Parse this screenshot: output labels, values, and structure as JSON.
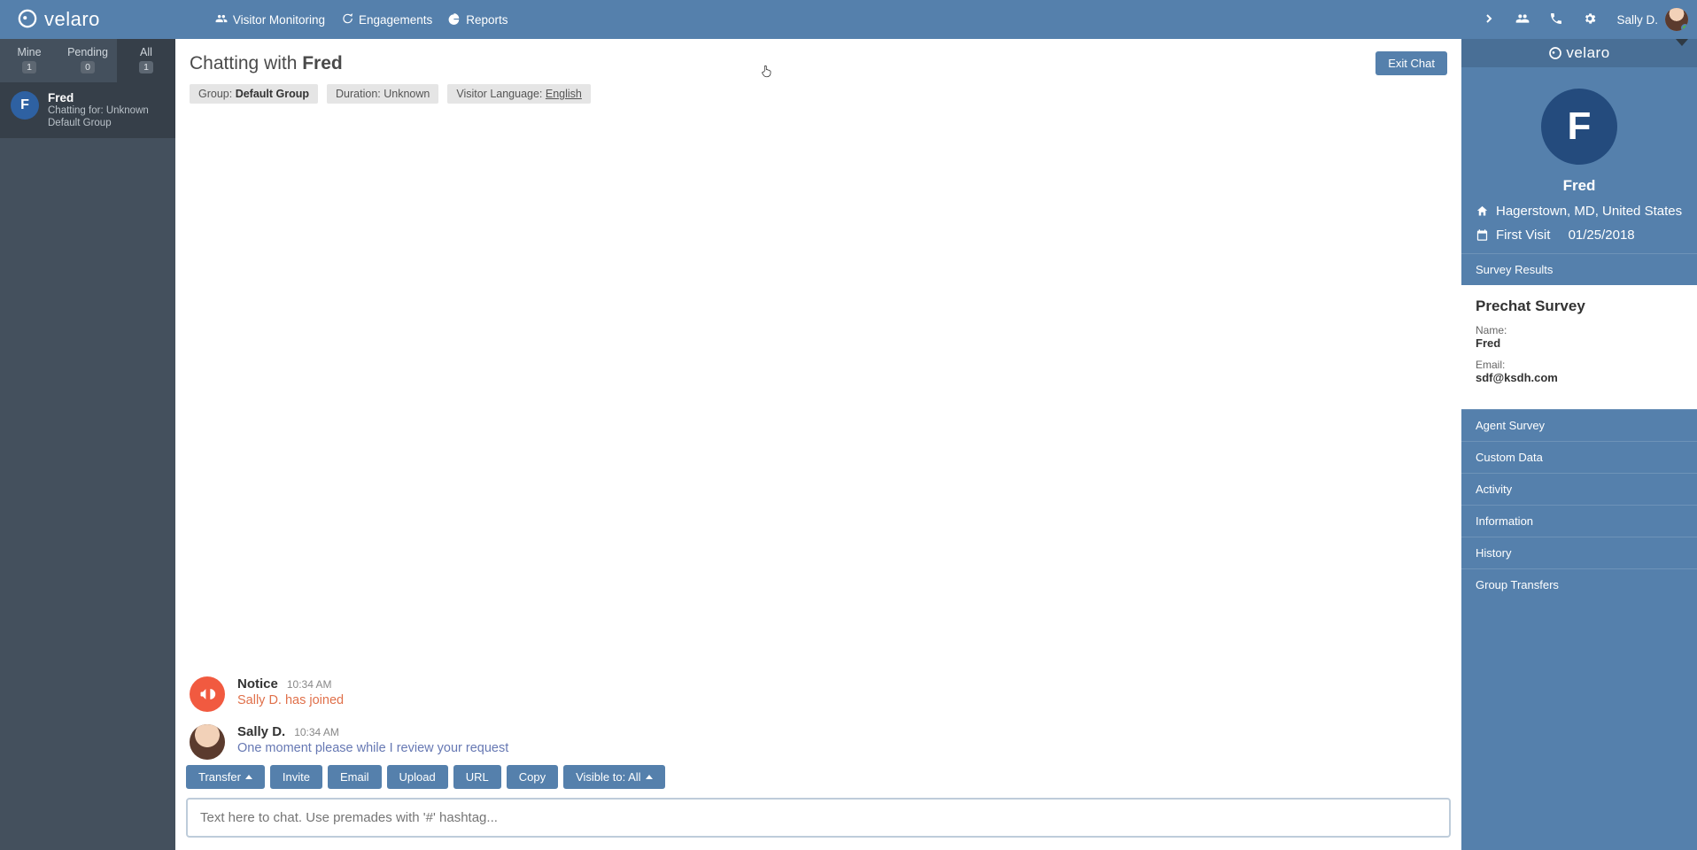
{
  "brand": "velaro",
  "topnav": {
    "monitoring": "Visitor Monitoring",
    "engagements": "Engagements",
    "reports": "Reports"
  },
  "user": {
    "name": "Sally D."
  },
  "sidebar": {
    "tabs": [
      {
        "label": "Mine",
        "count": "1"
      },
      {
        "label": "Pending",
        "count": "0"
      },
      {
        "label": "All",
        "count": "1"
      }
    ],
    "chats": [
      {
        "initial": "F",
        "name": "Fred",
        "sub1": "Chatting for: Unknown",
        "sub2": "Default Group"
      }
    ]
  },
  "chat": {
    "title_prefix": "Chatting with ",
    "title_name": "Fred",
    "exit": "Exit Chat",
    "chips": {
      "group_label": "Group: ",
      "group_value": "Default Group",
      "duration": "Duration: Unknown",
      "lang_label": "Visitor Language: ",
      "lang_value": "English"
    },
    "messages": [
      {
        "kind": "notice",
        "name": "Notice",
        "time": "10:34 AM",
        "text": "Sally D. has joined"
      },
      {
        "kind": "agent",
        "name": "Sally D.",
        "time": "10:34 AM",
        "text": "One moment please while I review your request"
      }
    ],
    "actions": {
      "transfer": "Transfer",
      "invite": "Invite",
      "email": "Email",
      "upload": "Upload",
      "url": "URL",
      "copy": "Copy",
      "visible_label": "Visible to: All"
    },
    "input_placeholder": "Text here to chat. Use premades with '#' hashtag..."
  },
  "info": {
    "brand": "velaro",
    "visitor_initial": "F",
    "visitor_name": "Fred",
    "location": "Hagerstown, MD, United States",
    "first_visit_label": "First Visit",
    "first_visit_date": "01/25/2018",
    "sections": {
      "survey_results": "Survey Results",
      "prechat_title": "Prechat Survey",
      "name_label": "Name:",
      "name_value": "Fred",
      "email_label": "Email:",
      "email_value": "sdf@ksdh.com",
      "agent_survey": "Agent Survey",
      "custom_data": "Custom Data",
      "activity": "Activity",
      "information": "Information",
      "history": "History",
      "group_transfers": "Group Transfers"
    }
  }
}
